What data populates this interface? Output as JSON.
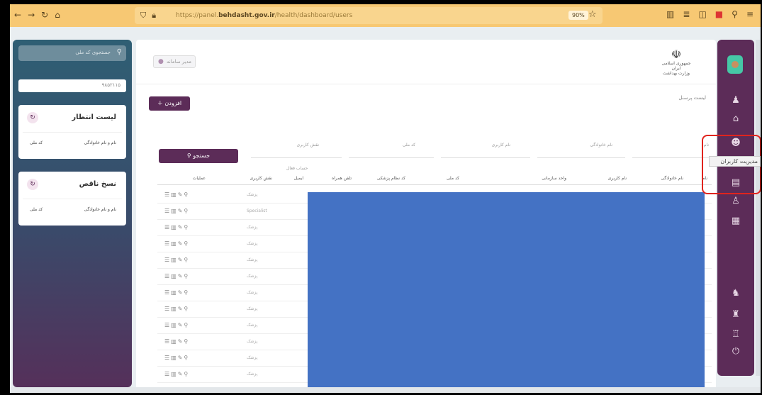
{
  "browser": {
    "nav": [
      "←",
      "→",
      "↻",
      "⌂"
    ],
    "url_pre": "https://panel.",
    "url_domain": "behdasht.gov.ir",
    "url_post": "/health/dashboard/users",
    "zoom": "90%",
    "toolbar_icons": [
      "bookmarks-icon",
      "library-icon",
      "sidebar-icon",
      "extension-icon",
      "account-icon",
      "menu-icon"
    ]
  },
  "header": {
    "user_button": "مدیر سامانه",
    "emblem_line1": "جمهوری اسلامی ایران",
    "emblem_line2": "وزارت بهداشت"
  },
  "page": {
    "title": "لیست پرسنل",
    "add_label": "افزودن",
    "search_label": "جستجو",
    "filters": [
      "نام",
      "نام خانوادگی",
      "نام کاربری",
      "کد ملی",
      "نقش کاربری"
    ],
    "filter_below": "حساب فعال"
  },
  "table": {
    "headers": [
      "نام",
      "نام خانوادگی",
      "نام کاربری",
      "واحد سازمانی",
      "کد ملی",
      "کد نظام پزشکی",
      "تلفن همراه",
      "ایمیل",
      "نقش کاربری",
      "عملیات"
    ],
    "rows": [
      {
        "role": "پزشک"
      },
      {
        "role": "Specialist"
      },
      {
        "role": "پزشک"
      },
      {
        "role": "پزشک"
      },
      {
        "role": "پزشک"
      },
      {
        "role": "پزشک"
      },
      {
        "role": "پزشک"
      },
      {
        "role": "پزشک"
      },
      {
        "role": "پزشک"
      },
      {
        "role": "پزشک"
      },
      {
        "role": "پزشک"
      },
      {
        "role": "پزشک"
      },
      {
        "role": "پزشک"
      }
    ]
  },
  "left_panel": {
    "search_placeholder": "جستجوی کد ملی",
    "code_value": "۹۸۵۲۱۱۵",
    "waiting_list": {
      "title": "لیست انتظار",
      "col1": "نام و نام خانوادگی",
      "col2": "کد ملی"
    },
    "incomplete": {
      "title": "نسخ ناقص",
      "col1": "نام و نام خانوادگی",
      "col2": "کد ملی"
    }
  },
  "sidebar": {
    "tooltip": "مدیریت کاربران",
    "icons": [
      "user-icon",
      "home-icon",
      "users-management-icon",
      "report-icon",
      "doctor-icon",
      "document-icon",
      "add-user-icon",
      "group-icon",
      "team-icon",
      "power-icon"
    ]
  },
  "colors": {
    "accent": "#5c2c58",
    "highlight": "#e0241e",
    "block": "#4472c4"
  }
}
